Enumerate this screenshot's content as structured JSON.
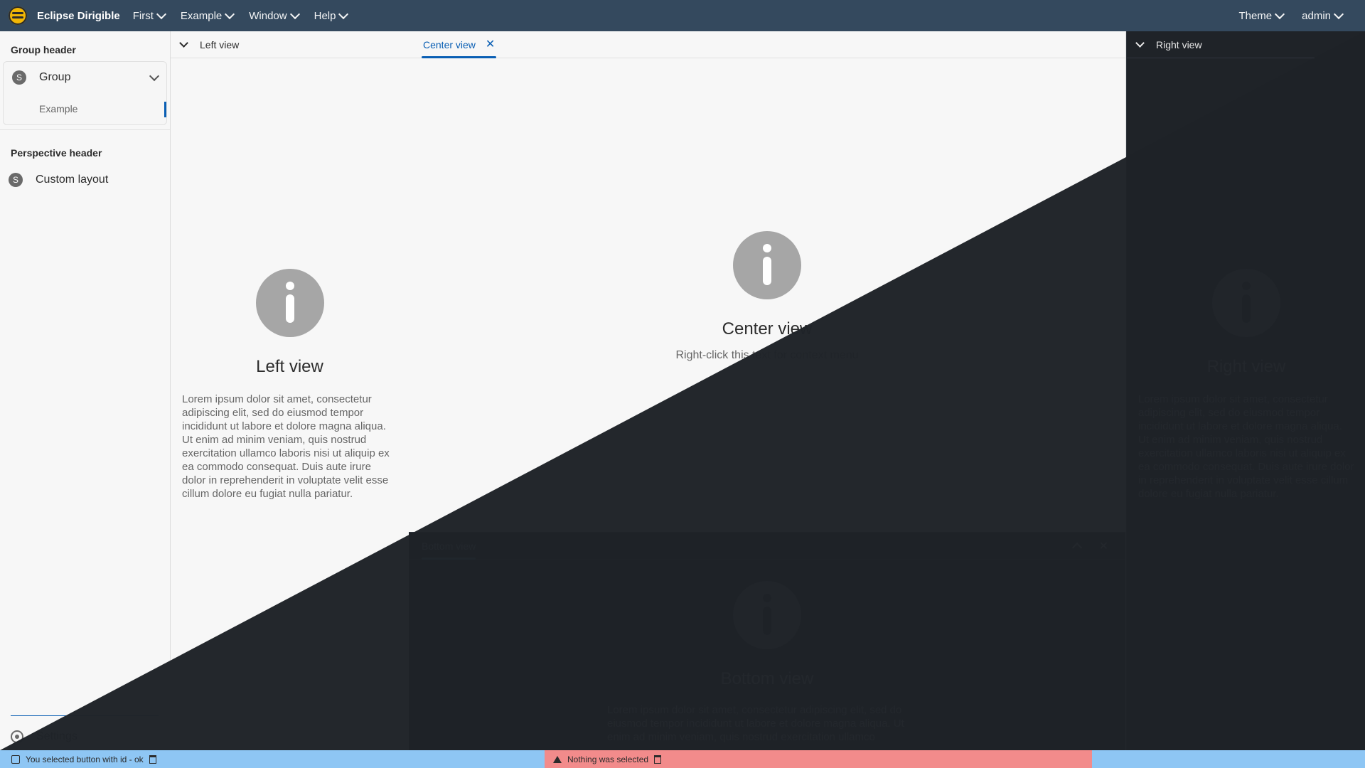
{
  "app": {
    "title": "Eclipse Dirigible",
    "menus": [
      "First",
      "Example",
      "Window",
      "Help"
    ],
    "right_menus": [
      "Theme",
      "admin"
    ]
  },
  "sidebar": {
    "group_header": "Group header",
    "group_label": "Group",
    "group_item": "Example",
    "perspective_header": "Perspective header",
    "perspective_item": "Custom layout",
    "settings_label": "Settings"
  },
  "views": {
    "left": {
      "header": "Left view",
      "title": "Left view",
      "text": "Lorem ipsum dolor sit amet, consectetur adipiscing elit, sed do eiusmod tempor incididunt ut labore et dolore magna aliqua. Ut enim ad minim veniam, quis nostrud exercitation ullamco laboris nisi ut aliquip ex ea commodo consequat. Duis aute irure dolor in reprehenderit in voluptate velit esse cillum dolore eu fugiat nulla pariatur."
    },
    "center": {
      "tab": "Center view",
      "title": "Center view",
      "subtitle": "Right-click this text for context menu"
    },
    "right": {
      "header": "Right view",
      "title": "Right view",
      "text": "Lorem ipsum dolor sit amet, consectetur adipiscing elit, sed do eiusmod tempor incididunt ut labore et dolore magna aliqua. Ut enim ad minim veniam, quis nostrud exercitation ullamco laboris nisi ut aliquip ex ea commodo consequat. Duis aute irure dolor in reprehenderit in voluptate velit esse cillum dolore eu fugiat nulla pariatur."
    },
    "bottom": {
      "tab": "Bottom view",
      "title": "Bottom view",
      "text": "Lorem ipsum dolor sit amet, consectetur adipiscing elit, sed do eiusmod tempor incididunt ut labore et dolore magna aliqua. Ut enim ad minim veniam, quis nostrud exercitation ullamco"
    }
  },
  "status": {
    "left": "You selected button with id - ok",
    "mid": "Nothing was selected"
  },
  "colors": {
    "topbar": "#34495e",
    "accent": "#0a5fb4",
    "dark": "#1f2328",
    "status_blue": "#8ec6f4",
    "status_red": "#f28b8b"
  }
}
